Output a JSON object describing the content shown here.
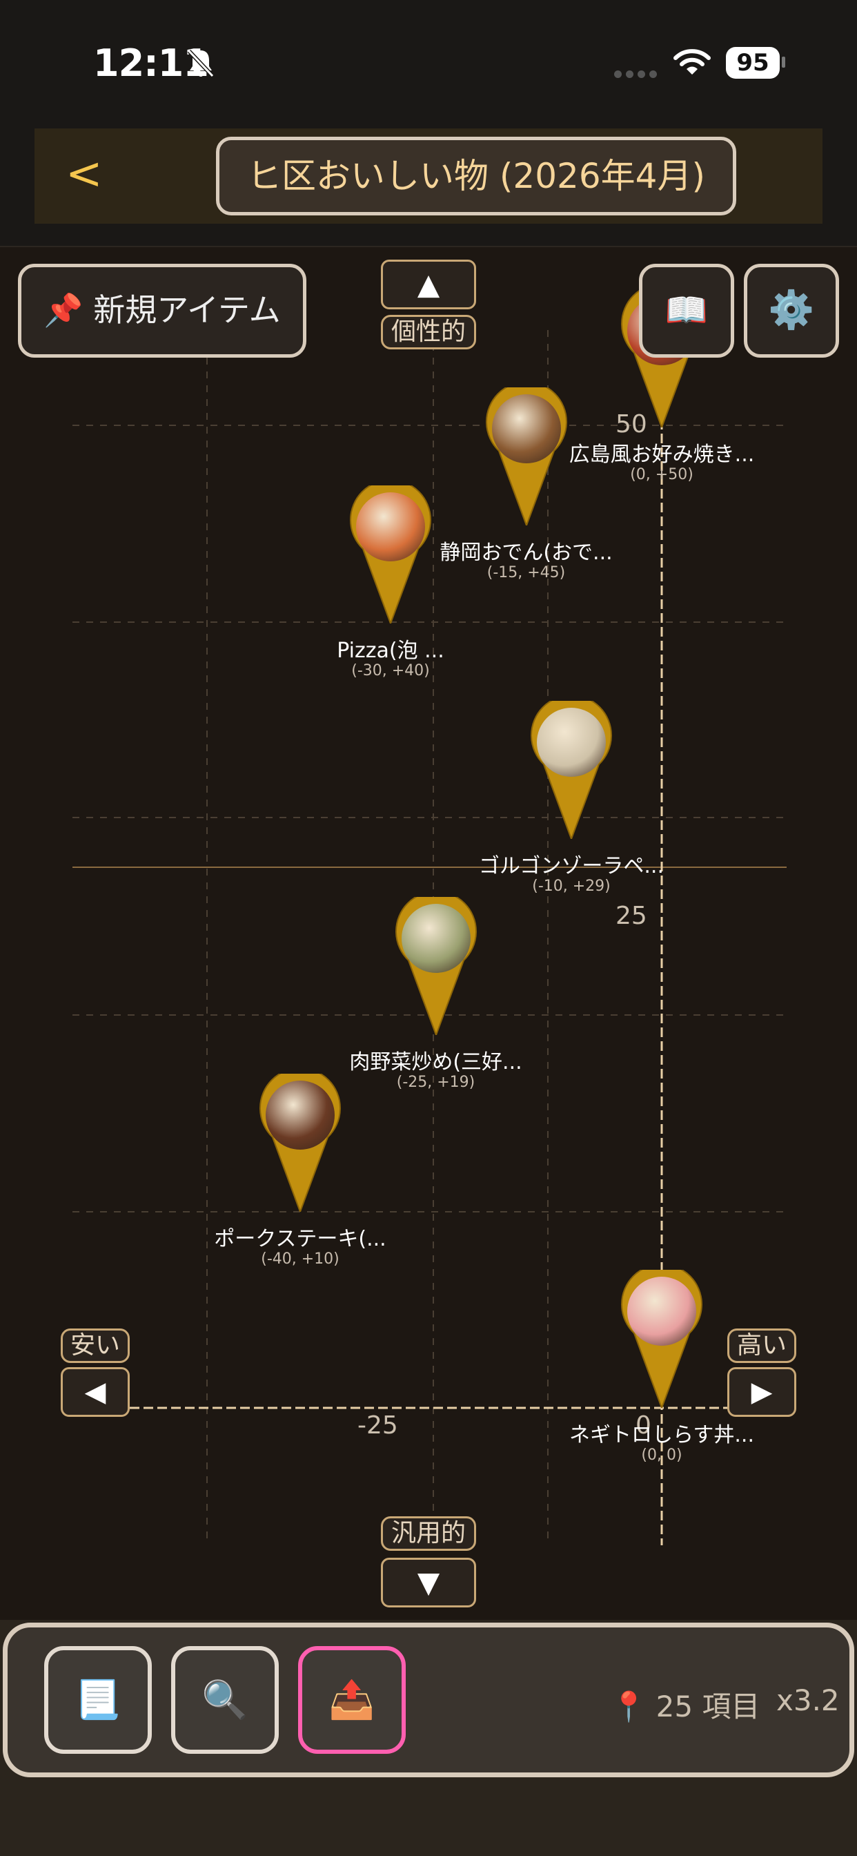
{
  "status": {
    "time": "12:11",
    "battery": "95"
  },
  "header": {
    "back_label": "<",
    "title": "ヒ区おいしい物 (2026年4月)"
  },
  "overlay": {
    "new_item_label": "📌 新規アイテム",
    "book_icon": "📖",
    "gear_icon": "⚙️"
  },
  "axes": {
    "top_label": "個性的",
    "bottom_label": "汎用的",
    "left_label": "安い",
    "right_label": "高い",
    "up_arrow": "▲",
    "down_arrow": "▼",
    "left_arrow": "◀",
    "right_arrow": "▶",
    "ticks": {
      "y50": "50",
      "y25": "25",
      "x0": "0",
      "xm25": "-25"
    }
  },
  "chart_data": {
    "type": "scatter",
    "xlabel": "安い ← → 高い",
    "ylabel": "汎用的 ← → 個性的",
    "points": [
      {
        "name": "広島風お好み焼き...",
        "coord": "(0, +50)",
        "x": 0,
        "y": 50
      },
      {
        "name": "静岡おでん(おで...",
        "coord": "(-15, +45)",
        "x": -15,
        "y": 45
      },
      {
        "name": "Pizza(泡 ...",
        "coord": "(-30, +40)",
        "x": -30,
        "y": 40
      },
      {
        "name": "ゴルゴンゾーラペ...",
        "coord": "(-10, +29)",
        "x": -10,
        "y": 29
      },
      {
        "name": "肉野菜炒め(三好...",
        "coord": "(-25, +19)",
        "x": -25,
        "y": 19
      },
      {
        "name": "ポークステーキ(...",
        "coord": "(-40, +10)",
        "x": -40,
        "y": 10
      },
      {
        "name": "ネギトロしらす丼...",
        "coord": "(0, 0)",
        "x": 0,
        "y": 0
      }
    ]
  },
  "toolbar": {
    "list_icon": "📃",
    "search_icon": "🔍",
    "export_icon": "📤",
    "count_label": "📍 25 項目",
    "zoom_label": "x3.2"
  },
  "colors": {
    "pin_gold": "#c2900f",
    "accent_pink": "#ff5fb0",
    "title_text": "#f6d59a",
    "back_arrow": "#f5c64e"
  }
}
